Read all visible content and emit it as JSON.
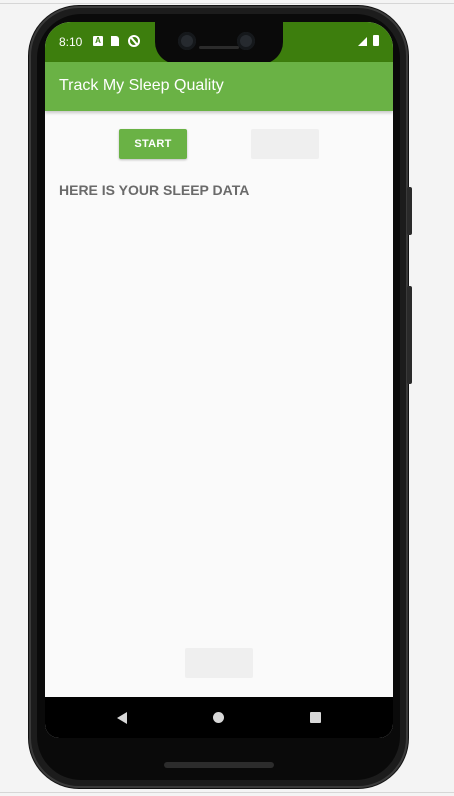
{
  "status_bar": {
    "time": "8:10",
    "notification_a": "A",
    "icons": [
      "a-notification-icon",
      "sd-card-icon",
      "no-disturb-icon",
      "signal-icon",
      "battery-icon"
    ]
  },
  "app_bar": {
    "title": "Track My Sleep Quality"
  },
  "controls": {
    "start_label": "START",
    "stop_label": "",
    "clear_label": ""
  },
  "content": {
    "heading": "HERE IS YOUR SLEEP DATA"
  },
  "nav_bar": {
    "icons": [
      "back-icon",
      "home-icon",
      "recents-icon"
    ]
  },
  "colors": {
    "status_bar": "#3d7e0d",
    "app_bar": "#6ab245",
    "accent": "#6ab245",
    "background": "#fafafa"
  }
}
